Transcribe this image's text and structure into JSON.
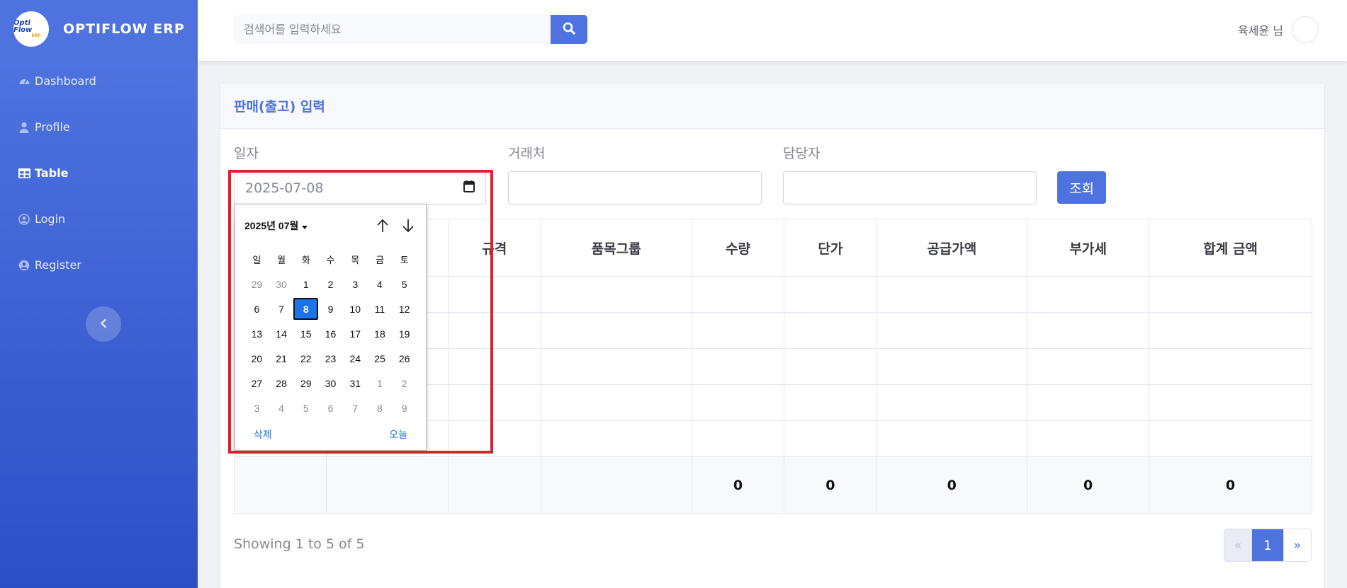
{
  "brand": {
    "logo_top": "Opti Flow",
    "logo_bottom": "ERP",
    "name": "OPTIFLOW ERP"
  },
  "sidebar": {
    "items": [
      {
        "label": "Dashboard",
        "icon": "gauge-icon",
        "active": false
      },
      {
        "label": "Profile",
        "icon": "user-icon",
        "active": false
      },
      {
        "label": "Table",
        "icon": "table-icon",
        "active": true
      },
      {
        "label": "Login",
        "icon": "user-circle-icon",
        "active": false
      },
      {
        "label": "Register",
        "icon": "user-circle-icon",
        "active": false
      }
    ],
    "toggle_icon": "chevron-left-icon"
  },
  "topbar": {
    "search_placeholder": "검색어를 입력하세요",
    "user_name": "육세윤 님"
  },
  "page": {
    "title": "판매(출고) 입력",
    "fields": {
      "date_label": "일자",
      "date_value": "2025-07-08",
      "client_label": "거래처",
      "manager_label": "담당자"
    },
    "query_button": "조회"
  },
  "table": {
    "headers": [
      "",
      "",
      "규격",
      "품목그룹",
      "수량",
      "단가",
      "공급가액",
      "부가세",
      "합계 금액"
    ],
    "empty_rows": 5,
    "totals": [
      "",
      "",
      "",
      "",
      "0",
      "0",
      "0",
      "0",
      "0"
    ]
  },
  "footer": {
    "showing": "Showing 1 to 5 of 5",
    "pagination": {
      "prev": "«",
      "current": "1",
      "next": "»"
    }
  },
  "calendar": {
    "month_label": "2025년 07월",
    "weekdays": [
      "일",
      "월",
      "화",
      "수",
      "목",
      "금",
      "토"
    ],
    "weeks": [
      [
        "29",
        "30",
        "1",
        "2",
        "3",
        "4",
        "5"
      ],
      [
        "6",
        "7",
        "8",
        "9",
        "10",
        "11",
        "12"
      ],
      [
        "13",
        "14",
        "15",
        "16",
        "17",
        "18",
        "19"
      ],
      [
        "20",
        "21",
        "22",
        "23",
        "24",
        "25",
        "26"
      ],
      [
        "27",
        "28",
        "29",
        "30",
        "31",
        "1",
        "2"
      ],
      [
        "3",
        "4",
        "5",
        "6",
        "7",
        "8",
        "9"
      ]
    ],
    "muted": [
      [
        0,
        0
      ],
      [
        0,
        1
      ],
      [
        4,
        5
      ],
      [
        4,
        6
      ],
      [
        5,
        0
      ],
      [
        5,
        1
      ],
      [
        5,
        2
      ],
      [
        5,
        3
      ],
      [
        5,
        4
      ],
      [
        5,
        5
      ],
      [
        5,
        6
      ]
    ],
    "selected": [
      1,
      2
    ],
    "clear_label": "삭제",
    "today_label": "오늘"
  },
  "colors": {
    "accent": "#4e73df",
    "highlight": "#e0202a",
    "selected_day": "#1a73e8"
  }
}
